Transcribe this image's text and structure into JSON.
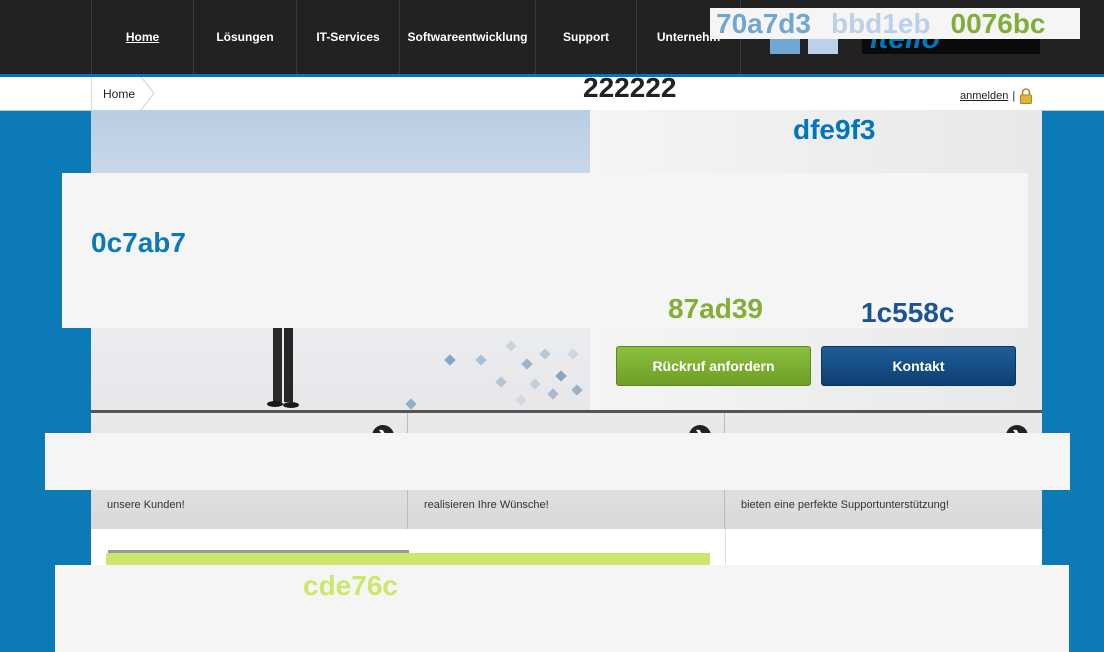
{
  "nav": {
    "items": [
      {
        "label": "Home",
        "active": true
      },
      {
        "label": "Lösungen"
      },
      {
        "label": "IT-Services"
      },
      {
        "label": "Softwareentwicklung"
      },
      {
        "label": "Support"
      },
      {
        "label": "Unternehm"
      }
    ]
  },
  "logo": {
    "word": "itello"
  },
  "color_swatches": [
    {
      "label": "70a7d3",
      "color": "#70a7d3"
    },
    {
      "label": "bbd1eb",
      "color": "#bbd1eb"
    },
    {
      "label": "0076bc",
      "color": "#7fae3a"
    }
  ],
  "breadcrumb": {
    "home": "Home",
    "tag": "222222"
  },
  "account": {
    "login": "anmelden",
    "separator": "|"
  },
  "side": {
    "tag": "dfe9f3"
  },
  "buttons": {
    "callback": "Rückruf anfordern",
    "contact": "Kontakt"
  },
  "overlay": {
    "t1": "0c7ab7",
    "t2": "87ad39",
    "t3": "1c558c"
  },
  "boxes": [
    {
      "text": "unsere Kunden!"
    },
    {
      "text": "realisieren Ihre Wünsche!"
    },
    {
      "text": "bieten eine perfekte Supportunterstützung!"
    }
  ],
  "footer": {
    "tag": "cde76c"
  },
  "colors": {
    "page_bg": "#0c7ab7",
    "topbar": "#222222",
    "accent_blue": "#0076bc",
    "green": "#87ad39",
    "dark_blue": "#1c558c",
    "light_green": "#cde76c",
    "panel": "#f5f5f5"
  }
}
